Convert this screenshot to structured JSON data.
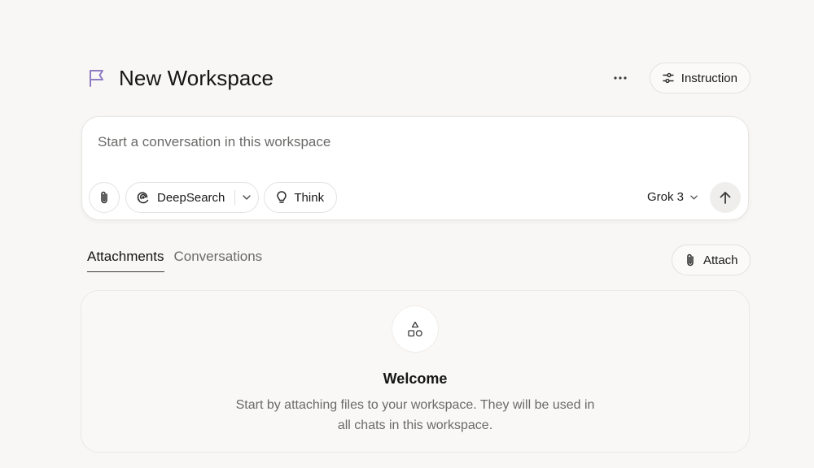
{
  "header": {
    "title": "New Workspace",
    "more_icon": "more-horizontal-icon",
    "instruction_label": "Instruction"
  },
  "composer": {
    "placeholder": "Start a conversation in this workspace",
    "deepsearch_label": "DeepSearch",
    "think_label": "Think",
    "model": "Grok 3"
  },
  "tabs": [
    {
      "label": "Attachments",
      "active": true
    },
    {
      "label": "Conversations",
      "active": false
    }
  ],
  "attach_label": "Attach",
  "welcome": {
    "title": "Welcome",
    "text": "Start by attaching files to your workspace. They will be used in all chats in this workspace."
  },
  "colors": {
    "accent": "#8e7cc3",
    "background": "#f8f7f6",
    "muted_text": "#6b6a68"
  }
}
